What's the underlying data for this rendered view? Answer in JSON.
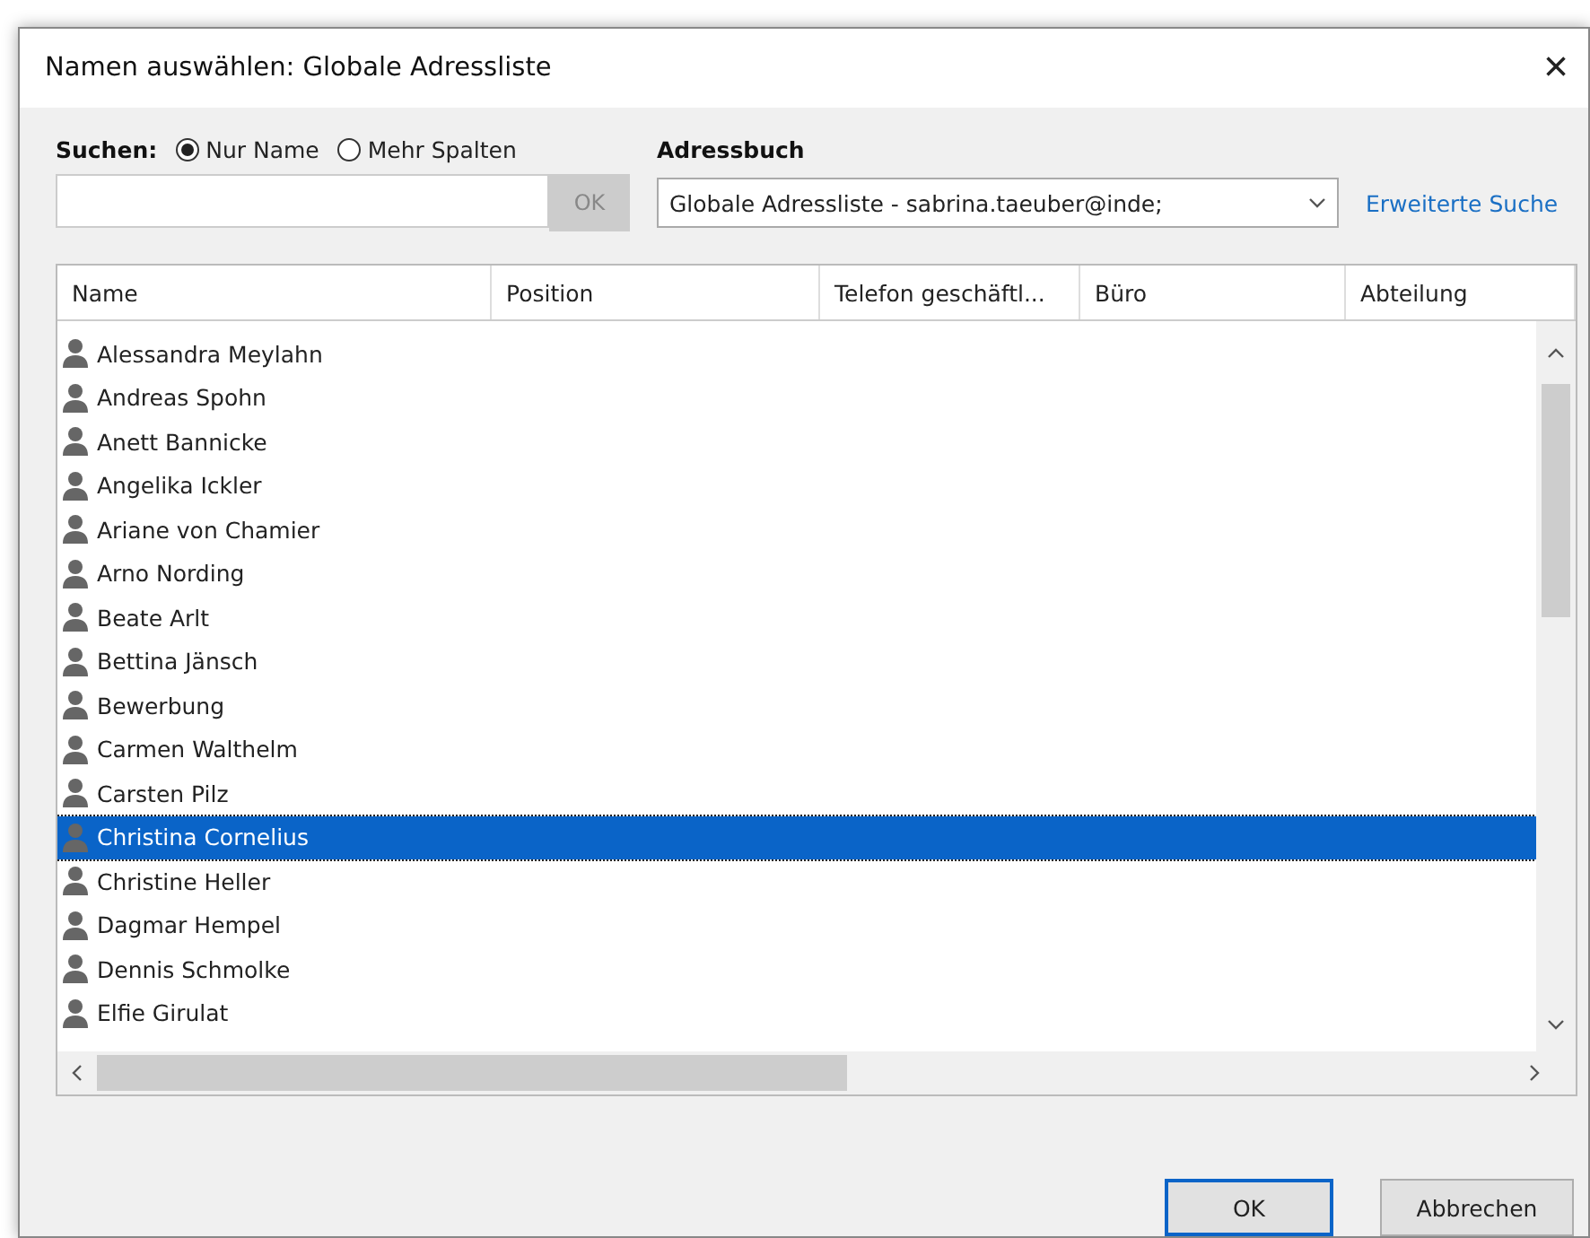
{
  "window": {
    "title": "Namen auswählen: Globale Adressliste",
    "close": "×"
  },
  "search": {
    "label": "Suchen:",
    "options": [
      {
        "label": "Nur Name",
        "selected": true
      },
      {
        "label": "Mehr Spalten",
        "selected": false
      }
    ],
    "button": "OK"
  },
  "address_book": {
    "label": "Adressbuch",
    "value": "Globale Adressliste - sabrina.taeuber@inde;",
    "link": "Erweiterte Suche"
  },
  "table": {
    "columns": [
      "Name",
      "Position",
      "Telefon geschäftl...",
      "Büro",
      "Abteilung"
    ],
    "rows": [
      {
        "name": "Alessandra Meylahn",
        "selected": false
      },
      {
        "name": "Andreas Spohn",
        "selected": false
      },
      {
        "name": "Anett Bannicke",
        "selected": false
      },
      {
        "name": "Angelika Ickler",
        "selected": false
      },
      {
        "name": "Ariane von Chamier",
        "selected": false
      },
      {
        "name": "Arno Nording",
        "selected": false
      },
      {
        "name": "Beate Arlt",
        "selected": false
      },
      {
        "name": "Bettina Jänsch",
        "selected": false
      },
      {
        "name": "Bewerbung",
        "selected": false
      },
      {
        "name": "Carmen Walthelm",
        "selected": false
      },
      {
        "name": "Carsten Pilz",
        "selected": false
      },
      {
        "name": "Christina Cornelius",
        "selected": true
      },
      {
        "name": "Christine Heller",
        "selected": false
      },
      {
        "name": "Dagmar Hempel",
        "selected": false
      },
      {
        "name": "Dennis Schmolke",
        "selected": false
      },
      {
        "name": "Elfie Girulat",
        "selected": false
      }
    ]
  },
  "buttons": [
    "OK",
    "Abbrechen"
  ]
}
